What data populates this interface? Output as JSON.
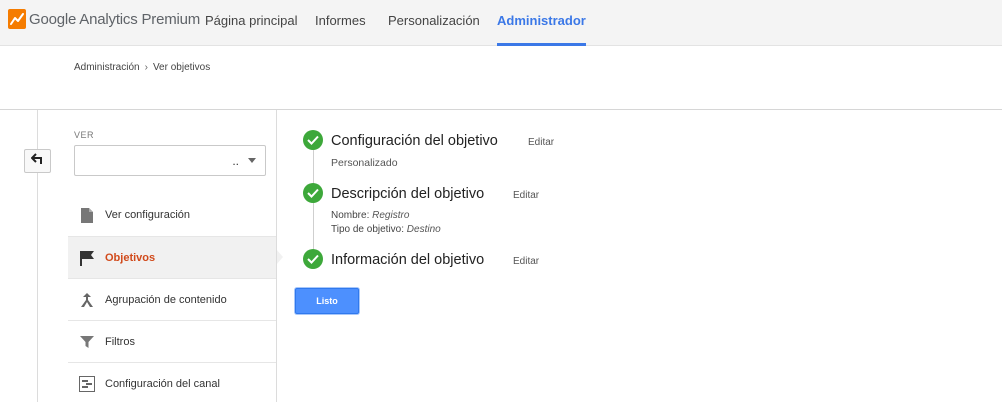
{
  "brand": {
    "logo_text": "Google Analytics Premium"
  },
  "nav": {
    "items": [
      {
        "label": "Página principal"
      },
      {
        "label": "Informes"
      },
      {
        "label": "Personalización"
      },
      {
        "label": "Administrador",
        "active": true
      }
    ]
  },
  "breadcrumb": {
    "items": [
      "Administración",
      "Ver objetivos"
    ],
    "separator": "›"
  },
  "left_panel": {
    "ver_label": "VER",
    "ver_select_value": "..",
    "menu": [
      {
        "label": "Ver configuración",
        "icon": "document-icon"
      },
      {
        "label": "Objetivos",
        "icon": "flag-icon",
        "active": true
      },
      {
        "label": "Agrupación de contenido",
        "icon": "merge-arrows-icon"
      },
      {
        "label": "Filtros",
        "icon": "filter-icon"
      },
      {
        "label": "Configuración del canal",
        "icon": "channel-settings-icon"
      }
    ]
  },
  "steps": [
    {
      "title": "Configuración del objetivo",
      "edit": "Editar",
      "subtitle": "Personalizado"
    },
    {
      "title": "Descripción del objetivo",
      "edit": "Editar",
      "name_label": "Nombre:",
      "name_value": "Registro",
      "type_label": "Tipo de objetivo:",
      "type_value": "Destino"
    },
    {
      "title": "Información del objetivo",
      "edit": "Editar"
    }
  ],
  "done_button": "Listo",
  "colors": {
    "accent_blue": "#3b78e7",
    "active_menu": "#d14a1b",
    "check_green": "#3da83a",
    "button_blue": "#4d90fe"
  }
}
